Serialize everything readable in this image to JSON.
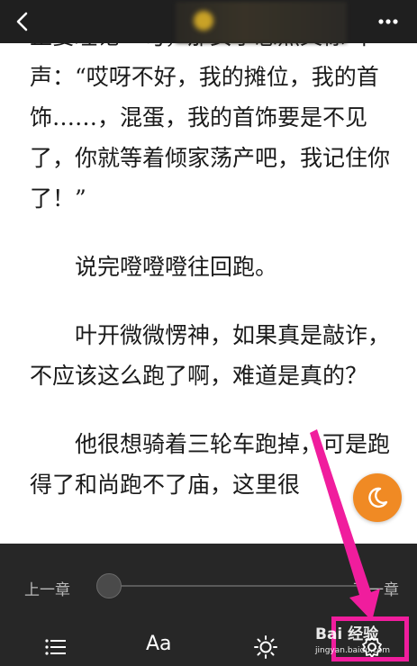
{
  "topbar": {
    "back_icon": "chevron-left-icon",
    "more_icon": "more-horizontal-icon"
  },
  "content": {
    "paragraphs": [
      {
        "text": "正要理论一句，那女子忽然又惊叫一声：“哎呀不好，我的摊位，我的首饰……，混蛋，我的首饰要是不见了，你就等着倾家荡产吧，我记住你了！”",
        "indent": false
      },
      {
        "text": "说完噔噔噔往回跑。",
        "indent": true
      },
      {
        "text": "叶开微微愣神，如果真是敲诈，不应该这么跑了啊，难道是真的？",
        "indent": true
      },
      {
        "text": "他很想骑着三轮车跑掉，可是跑得了和尚跑不了庙，这里很",
        "indent": true
      }
    ]
  },
  "night_mode_button": {
    "icon": "moon-icon",
    "color": "#f08a24"
  },
  "bottom_panel": {
    "prev_chapter": "上一章",
    "next_chapter": "下一章",
    "progress": 0.0,
    "toolbar": {
      "toc_icon": "list-icon",
      "font_label": "Aa",
      "brightness_icon": "sun-icon",
      "settings_icon": "gear-icon"
    }
  },
  "annotation": {
    "color": "#f01d9d",
    "watermark_main": "Bai 经验",
    "watermark_sub": "jingyan.baidu.com"
  }
}
